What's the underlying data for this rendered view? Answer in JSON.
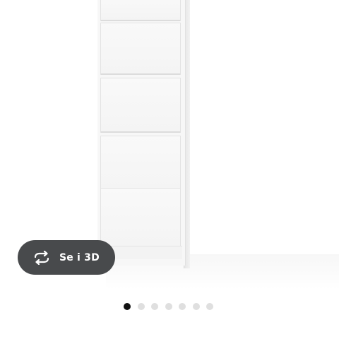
{
  "gallery": {
    "view_3d_label": "Se i 3D",
    "view_3d_icon": "rotate-3d-icon",
    "slide_count": 7,
    "active_slide_index": 0
  },
  "colors": {
    "button_background": "#484a4c",
    "button_text": "#ffffff",
    "dot_active": "#111111",
    "dot_inactive": "#dfdfdf"
  }
}
